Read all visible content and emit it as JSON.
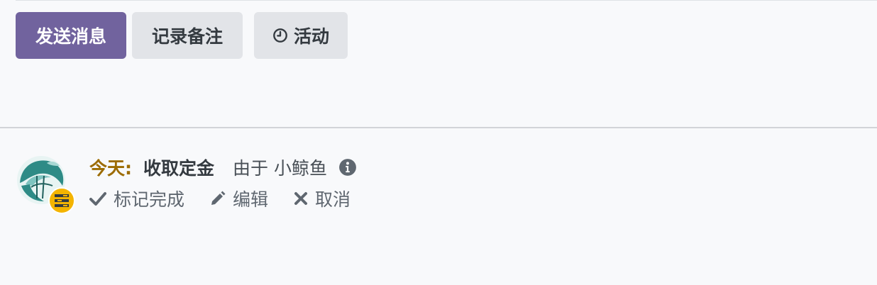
{
  "composer": {
    "send_message_label": "发送消息",
    "log_note_label": "记录备注",
    "activity_label": "活动"
  },
  "activity": {
    "due_label": "今天:",
    "summary": "收取定金",
    "assigned_by": "由于 小鲸鱼",
    "actions": {
      "mark_done": "标记完成",
      "edit": "编辑",
      "cancel": "取消"
    }
  },
  "colors": {
    "primary": "#71639e",
    "secondary_button": "#e2e4e8",
    "due_today": "#9c6b00",
    "badge": "#f4b400"
  },
  "icons": {
    "activity_button": "clock-icon",
    "info": "info-circle-icon",
    "mark_done": "check-icon",
    "edit": "pencil-icon",
    "cancel": "times-icon",
    "activity_type_badge": "tasks-icon"
  }
}
